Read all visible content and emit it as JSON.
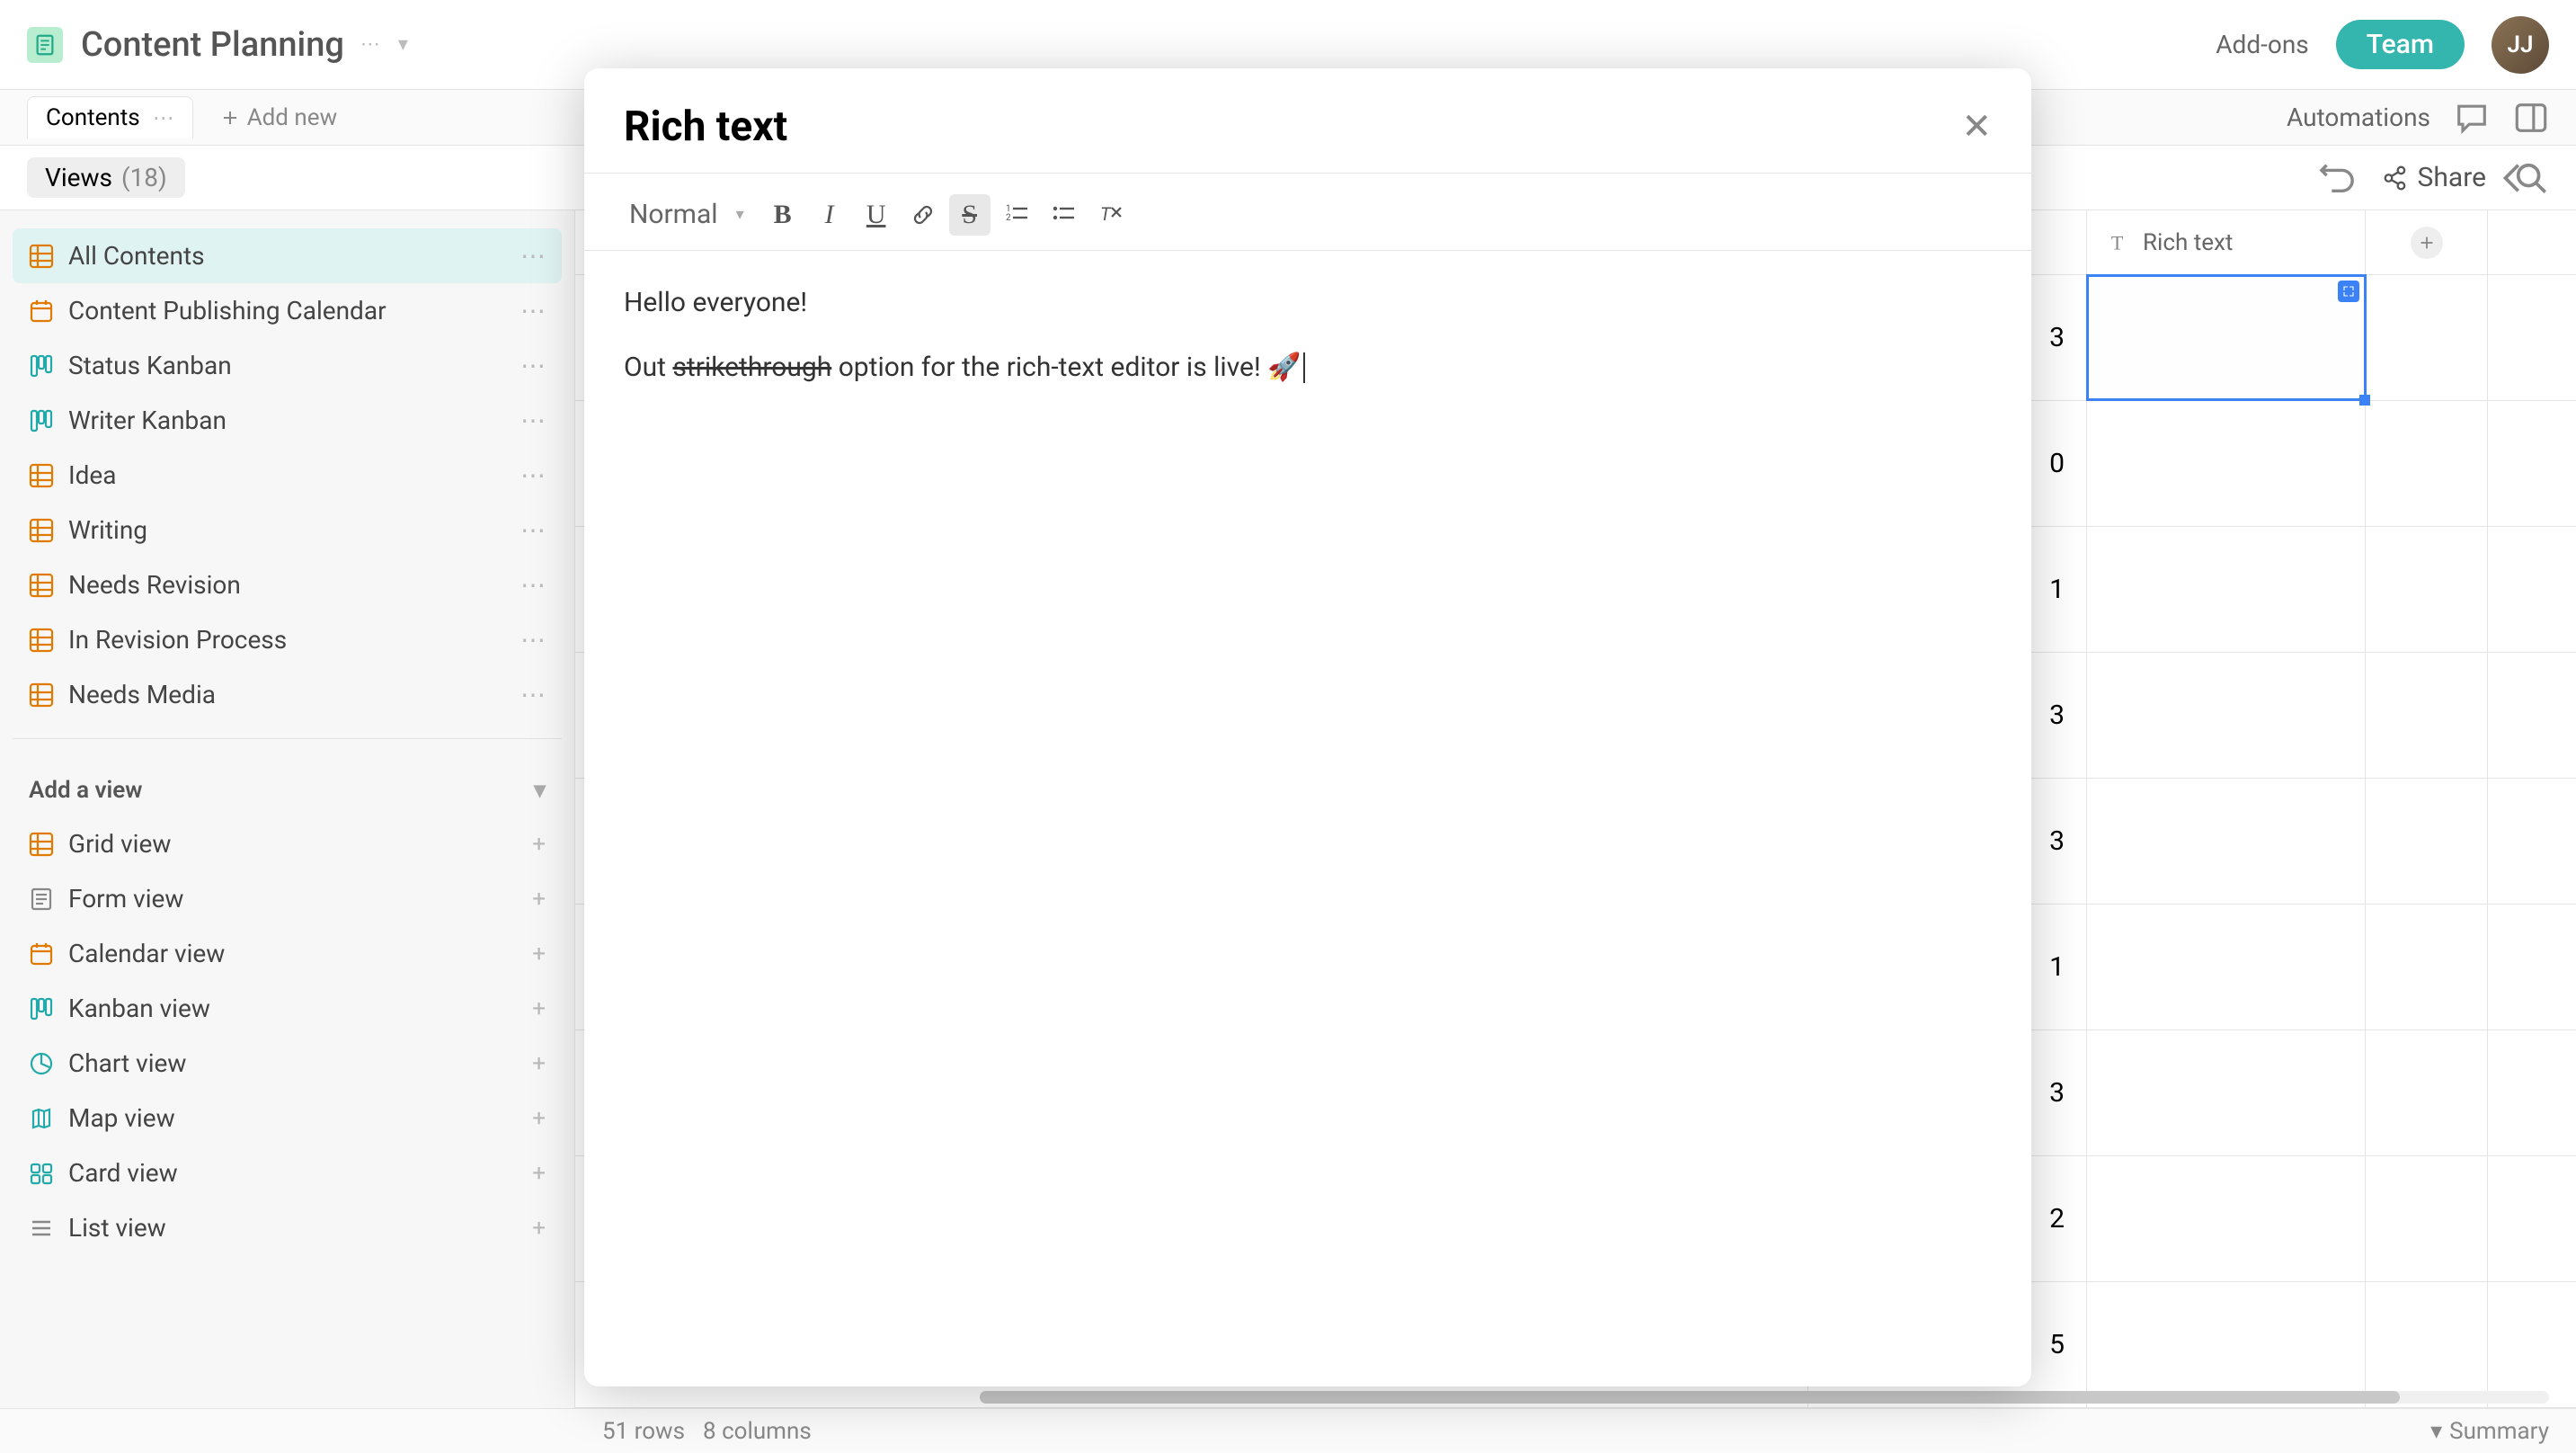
{
  "app": {
    "title": "Content Planning"
  },
  "topbar": {
    "add_ons": "Add-ons",
    "team": "Team",
    "avatar_initials": "JJ"
  },
  "tabs": {
    "active": "Contents",
    "add_new": "Add new"
  },
  "secondbar": {
    "automations": "Automations"
  },
  "views": {
    "label": "Views",
    "count": "(18)"
  },
  "toolbar_right": {
    "share": "Share"
  },
  "sidebar": {
    "views": [
      {
        "label": "All Contents",
        "icon": "grid",
        "selected": true
      },
      {
        "label": "Content Publishing Calendar",
        "icon": "calendar",
        "selected": false
      },
      {
        "label": "Status Kanban",
        "icon": "kanban",
        "selected": false
      },
      {
        "label": "Writer Kanban",
        "icon": "kanban",
        "selected": false
      },
      {
        "label": "Idea",
        "icon": "grid",
        "selected": false
      },
      {
        "label": "Writing",
        "icon": "grid",
        "selected": false
      },
      {
        "label": "Needs Revision",
        "icon": "grid",
        "selected": false
      },
      {
        "label": "In Revision Process",
        "icon": "grid",
        "selected": false
      },
      {
        "label": "Needs Media",
        "icon": "grid",
        "selected": false
      }
    ],
    "add_view_heading": "Add a view",
    "add_view_types": [
      {
        "label": "Grid view",
        "icon": "grid"
      },
      {
        "label": "Form view",
        "icon": "form"
      },
      {
        "label": "Calendar view",
        "icon": "calendar"
      },
      {
        "label": "Kanban view",
        "icon": "kanban"
      },
      {
        "label": "Chart view",
        "icon": "chart"
      },
      {
        "label": "Map view",
        "icon": "map"
      },
      {
        "label": "Card view",
        "icon": "card"
      },
      {
        "label": "List view",
        "icon": "list"
      }
    ]
  },
  "grid": {
    "column_header": "Rich text",
    "rows": [
      "3",
      "0",
      "1",
      "3",
      "3",
      "1",
      "3",
      "2",
      "5"
    ]
  },
  "statusbar": {
    "rows": "51 rows",
    "cols": "8 columns",
    "summary": "Summary"
  },
  "modal": {
    "title": "Rich text",
    "format_label": "Normal",
    "content": {
      "line1": "Hello everyone!",
      "line2_prefix": "Out ",
      "line2_strike": "strikethrough",
      "line2_suffix": " option for the rich-text editor is live! 🚀"
    }
  }
}
